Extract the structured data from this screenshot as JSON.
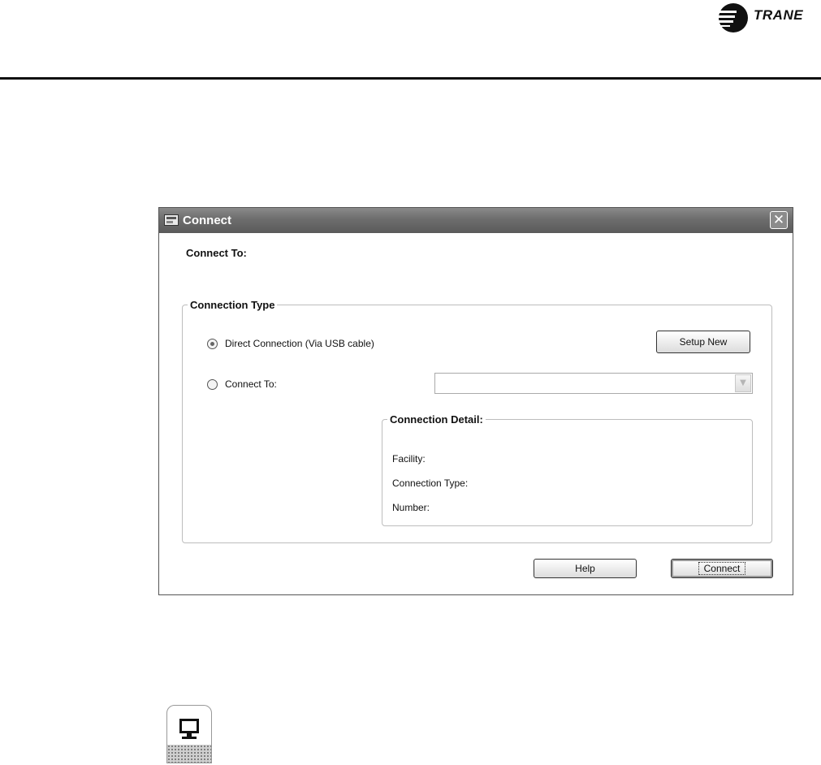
{
  "header": {
    "brand": "TRANE"
  },
  "dialog": {
    "title": "Connect",
    "close_glyph": "✕",
    "connect_to_heading": "Connect To:",
    "connection_type": {
      "legend": "Connection Type",
      "options": [
        {
          "label": "Direct Connection (Via USB cable)",
          "checked": true
        },
        {
          "label": "Connect To:",
          "checked": false
        }
      ],
      "setup_new_label": "Setup New",
      "connect_to_value": ""
    },
    "connection_detail": {
      "legend": "Connection Detail:",
      "fields": [
        "Facility:",
        "Connection Type:",
        "Number:"
      ]
    },
    "buttons": {
      "help": "Help",
      "connect": "Connect"
    }
  },
  "icons": {
    "brand_logo": "trane-logo-icon",
    "window": "connect-window-icon",
    "close": "close-icon",
    "dropdown": "chevron-down-icon",
    "monitor": "monitor-icon"
  },
  "colors": {
    "titlebar": "#6d6d6d",
    "header_rule": "#111111"
  }
}
